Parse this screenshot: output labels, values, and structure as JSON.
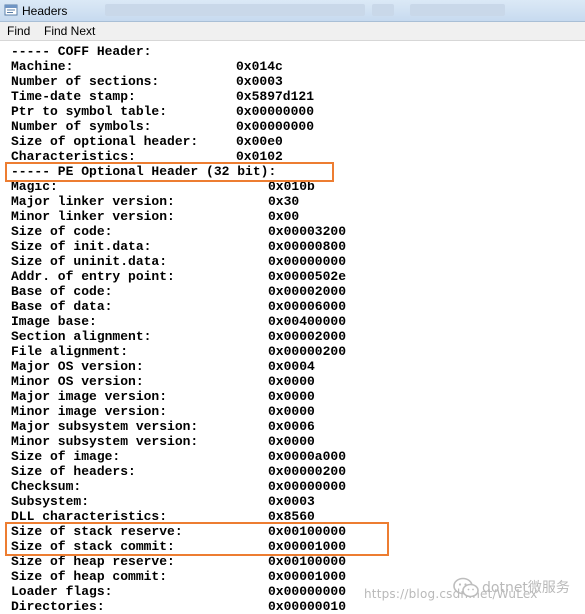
{
  "window": {
    "title": "Headers",
    "accent_color": "#ed7d31"
  },
  "menu": {
    "find_label": "Find",
    "find_next_label": "Find Next"
  },
  "coff_header": {
    "heading": "----- COFF Header:",
    "fields": [
      {
        "label": "Machine:",
        "value": "0x014c"
      },
      {
        "label": "Number of sections:",
        "value": "0x0003"
      },
      {
        "label": "Time-date stamp:",
        "value": "0x5897d121"
      },
      {
        "label": "Ptr to symbol table:",
        "value": "0x00000000"
      },
      {
        "label": "Number of symbols:",
        "value": "0x00000000"
      },
      {
        "label": "Size of optional header:",
        "value": "0x00e0"
      },
      {
        "label": "Characteristics:",
        "value": "0x0102"
      }
    ]
  },
  "pe_header": {
    "heading": "----- PE Optional Header (32 bit):",
    "fields": [
      {
        "label": "Magic:",
        "value": "0x010b"
      },
      {
        "label": "Major linker version:",
        "value": "0x30"
      },
      {
        "label": "Minor linker version:",
        "value": "0x00"
      },
      {
        "label": "Size of code:",
        "value": "0x00003200"
      },
      {
        "label": "Size of init.data:",
        "value": "0x00000800"
      },
      {
        "label": "Size of uninit.data:",
        "value": "0x00000000"
      },
      {
        "label": "Addr. of entry point:",
        "value": "0x0000502e"
      },
      {
        "label": "Base of code:",
        "value": "0x00002000"
      },
      {
        "label": "Base of data:",
        "value": "0x00006000"
      },
      {
        "label": "Image base:",
        "value": "0x00400000"
      },
      {
        "label": "Section alignment:",
        "value": "0x00002000"
      },
      {
        "label": "File alignment:",
        "value": "0x00000200"
      },
      {
        "label": "Major OS version:",
        "value": "0x0004"
      },
      {
        "label": "Minor OS version:",
        "value": "0x0000"
      },
      {
        "label": "Major image version:",
        "value": "0x0000"
      },
      {
        "label": "Minor image version:",
        "value": "0x0000"
      },
      {
        "label": "Major subsystem version:",
        "value": "0x0006"
      },
      {
        "label": "Minor subsystem version:",
        "value": "0x0000"
      },
      {
        "label": "Size of image:",
        "value": "0x0000a000"
      },
      {
        "label": "Size of headers:",
        "value": "0x00000200"
      },
      {
        "label": "Checksum:",
        "value": "0x00000000"
      },
      {
        "label": "Subsystem:",
        "value": "0x0003"
      },
      {
        "label": "DLL characteristics:",
        "value": "0x8560"
      },
      {
        "label": "Size of stack reserve:",
        "value": "0x00100000"
      },
      {
        "label": "Size of stack commit:",
        "value": "0x00001000"
      },
      {
        "label": "Size of heap reserve:",
        "value": "0x00100000"
      },
      {
        "label": "Size of heap commit:",
        "value": "0x00001000"
      },
      {
        "label": "Loader flags:",
        "value": "0x00000000"
      },
      {
        "label": "Directories:",
        "value": "0x00000010"
      }
    ]
  },
  "watermark": {
    "url": "https://blog.csdn.net/WuLex",
    "brand": "dotnet微服务"
  }
}
